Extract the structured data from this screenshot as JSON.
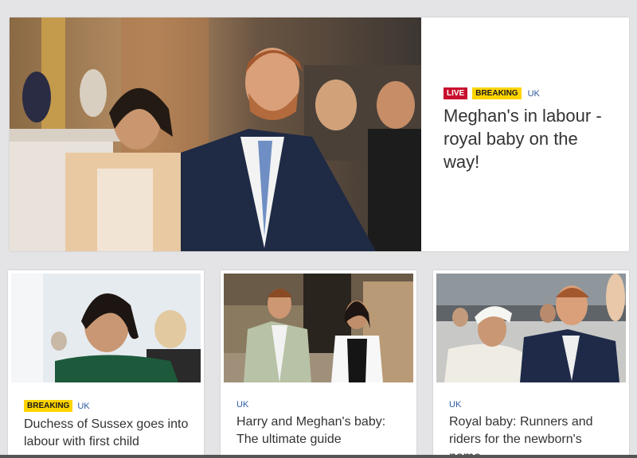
{
  "hero": {
    "tags": {
      "live": "LIVE",
      "breaking": "BREAKING",
      "category": "UK"
    },
    "headline": "Meghan's in labour - royal baby on the way!",
    "image_alt": "Meghan and Harry at an event in a gilded room"
  },
  "cards": [
    {
      "tags": {
        "breaking": "BREAKING",
        "category": "UK"
      },
      "headline": "Duchess of Sussex goes into labour with first child",
      "image_alt": "Meghan smiling in a green outfit"
    },
    {
      "tags": {
        "category": "UK"
      },
      "headline": "Harry and Meghan's baby: The ultimate guide",
      "image_alt": "Harry and Meghan walking outside a stone building"
    },
    {
      "tags": {
        "category": "UK"
      },
      "headline": "Royal baby: Runners and riders for the newborn's name",
      "image_alt": "Meghan and Harry in front of a crowd"
    }
  ],
  "colors": {
    "live": "#c8102e",
    "breaking": "#ffd400",
    "category": "#2c5aa0",
    "headline": "#333333"
  }
}
